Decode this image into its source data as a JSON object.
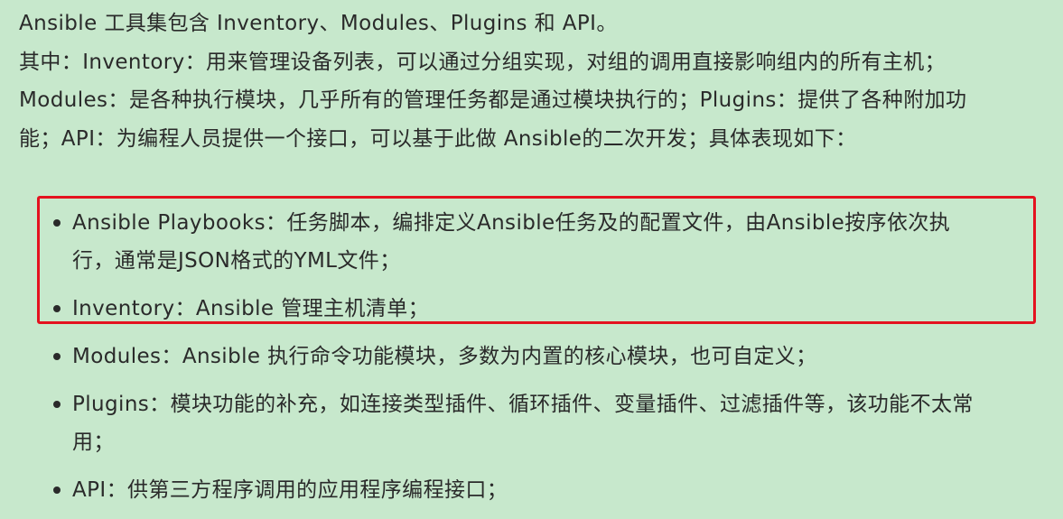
{
  "intro": "Ansible 工具集包含 Inventory、Modules、Plugins 和 API。",
  "description": "其中：Inventory：用来管理设备列表，可以通过分组实现，对组的调用直接影响组内的所有主机；Modules：是各种执行模块，几乎所有的管理任务都是通过模块执行的；Plugins：提供了各种附加功能；API：为编程人员提供一个接口，可以基于此做 Ansible的二次开发；具体表现如下：",
  "items": [
    "Ansible Playbooks：任务脚本，编排定义Ansible任务及的配置文件，由Ansible按序依次执行，通常是JSON格式的YML文件；",
    "Inventory：Ansible 管理主机清单；",
    "Modules：Ansible 执行命令功能模块，多数为内置的核心模块，也可自定义；",
    "Plugins：模块功能的补充，如连接类型插件、循环插件、变量插件、过滤插件等，该功能不太常用；",
    "API：供第三方程序调用的应用程序编程接口；"
  ],
  "colors": {
    "background": "#c7e8cc",
    "text": "#2a2a2a",
    "highlight_border": "#e4121f"
  }
}
